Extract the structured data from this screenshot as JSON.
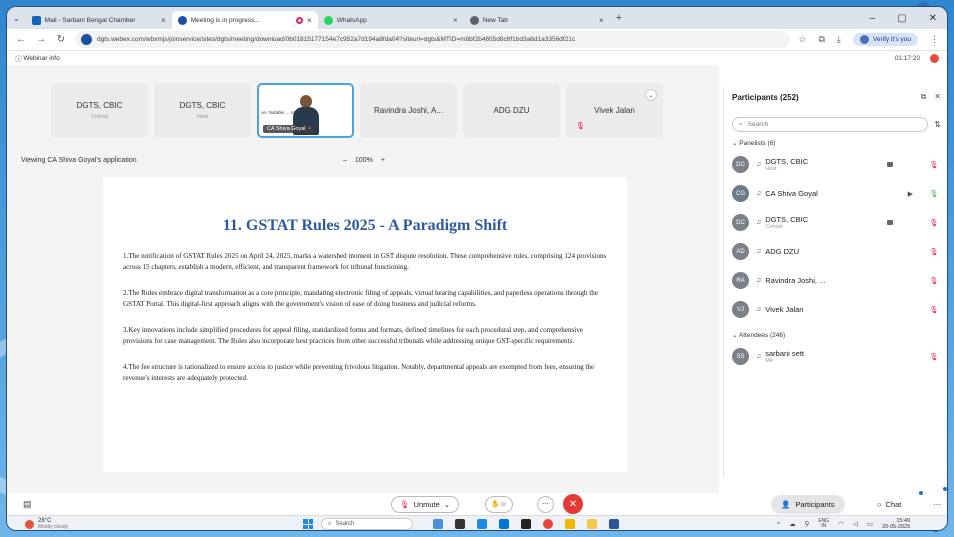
{
  "browser": {
    "tabs": [
      {
        "label": "Mail - Sarbani Bengal Chamber",
        "icon": "mail-icon",
        "color": "#1565c0"
      },
      {
        "label": "Meeting is in progress...",
        "icon": "webex-icon",
        "color": "#1a4fa3",
        "recording": true
      },
      {
        "label": "WhatsApp",
        "icon": "whatsapp-icon",
        "color": "#25d366"
      },
      {
        "label": "New Tab",
        "icon": "chrome-icon",
        "color": "#5f6368"
      }
    ],
    "url": "dgts.webex.com/wbxmjs/joinservice/sites/dgts/meeting/download/0b01815177154e7c952a7d194a8fda04?siteurl=dgts&MTID=m8bf2b4605d8c6f1bd3a6d1a3356df21c",
    "verify_label": "Verify it's you"
  },
  "meeting": {
    "info_label": "Webinar info",
    "timer": "01:17:20",
    "viewing_label": "Viewing CA Shiva Goyal's application",
    "zoom_minus": "–",
    "zoom_level": "100%",
    "zoom_plus": "+"
  },
  "thumbnails": [
    {
      "name": "DGTS, CBIC",
      "role": "Cohost"
    },
    {
      "name": "DGTS, CBIC",
      "role": "Host"
    },
    {
      "name": "CA Shiva Goyal",
      "caption": "on. Notable …  mental",
      "active": true
    },
    {
      "name": "Ravindra Joshi, A...",
      "role": ""
    },
    {
      "name": "ADG DZU",
      "role": ""
    },
    {
      "name": "Vivek Jalan",
      "role": ""
    }
  ],
  "document": {
    "title": "11. GSTAT Rules 2025 - A Paradigm Shift",
    "paragraphs": [
      "1.The notification of GSTAT Rules 2025 on April 24, 2025, marks a watershed moment in GST dispute resolution. These comprehensive rules, comprising 124 provisions across 15 chapters, establish a modern, efficient, and transparent framework for tribunal functioning.",
      "2.The Rules embrace digital transformation as a core principle, mandating electronic filing of appeals, virtual hearing capabilities, and paperless operations through the GSTAT Portal. This digital-first approach aligns with the government's vision of ease of doing business and judicial reforms.",
      "3.Key innovations include simplified procedures for appeal filing, standardized forms and formats, defined timelines for each procedural step, and comprehensive provisions for case management. The Rules also incorporate best practices from other successful tribunals while addressing unique GST-specific requirements.",
      "4.The fee structure is rationalized to ensure access to justice while preventing frivolous litigation. Notably, departmental appeals are exempted from fees, ensuring the revenue's interests are adequately protected."
    ]
  },
  "participants_panel": {
    "title": "Participants (252)",
    "search_placeholder": "Search",
    "panelists_label": "Panelists (6)",
    "attendees_label": "Attendees (246)",
    "panelists": [
      {
        "initials": "DC",
        "name": "DGTS, CBIC",
        "role": "Host",
        "sharing": true,
        "mic": "muted"
      },
      {
        "initials": "CG",
        "name": "CA Shiva Goyal",
        "role": "",
        "video": true,
        "mic": "on"
      },
      {
        "initials": "DC",
        "name": "DGTS, CBIC",
        "role": "Cohost",
        "sharing": true,
        "mic": "muted"
      },
      {
        "initials": "AD",
        "name": "ADG DZU",
        "role": "",
        "mic": "muted"
      },
      {
        "initials": "RA",
        "name": "Ravindra Joshi, ...",
        "role": "",
        "mic": "muted"
      },
      {
        "initials": "VJ",
        "name": "Vivek Jalan",
        "role": "",
        "mic": "muted"
      }
    ],
    "attendees": [
      {
        "initials": "SS",
        "name": "sarbani sett",
        "role": "Me",
        "mic": "muted"
      }
    ]
  },
  "controls": {
    "unmute_label": "Unmute",
    "participants_label": "Participants",
    "chat_label": "Chat"
  },
  "taskbar": {
    "temperature": "28°C",
    "weather": "Mostly cloudy",
    "search_label": "Search",
    "lang_top": "ENG",
    "lang_bottom": "IN",
    "time": "15:49",
    "date": "20-05-2025"
  },
  "colors": {
    "accent": "#4aa3df",
    "title_blue": "#2c5aa0",
    "end_red": "#e53935",
    "muted_red": "#e00044"
  }
}
